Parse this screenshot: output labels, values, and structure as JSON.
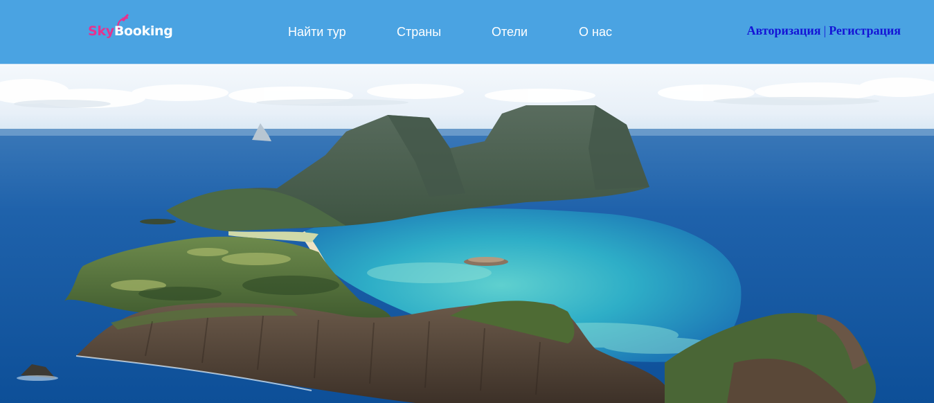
{
  "header": {
    "background_color": "#4aa3e2",
    "logo": {
      "part1": "Sky",
      "part2": "Booking",
      "part1_color": "#e5338f",
      "part2_color": "#ffffff",
      "icon": "airplane-swoosh-icon"
    },
    "nav": {
      "find_tour": "Найти тур",
      "countries": "Страны",
      "hotels": "Отели",
      "about": "О нас"
    },
    "auth": {
      "login": "Авторизация",
      "separator": "|",
      "register": "Регистрация",
      "link_color": "#1414d6"
    }
  },
  "hero": {
    "image_subject": "aerial-island-landscape"
  }
}
